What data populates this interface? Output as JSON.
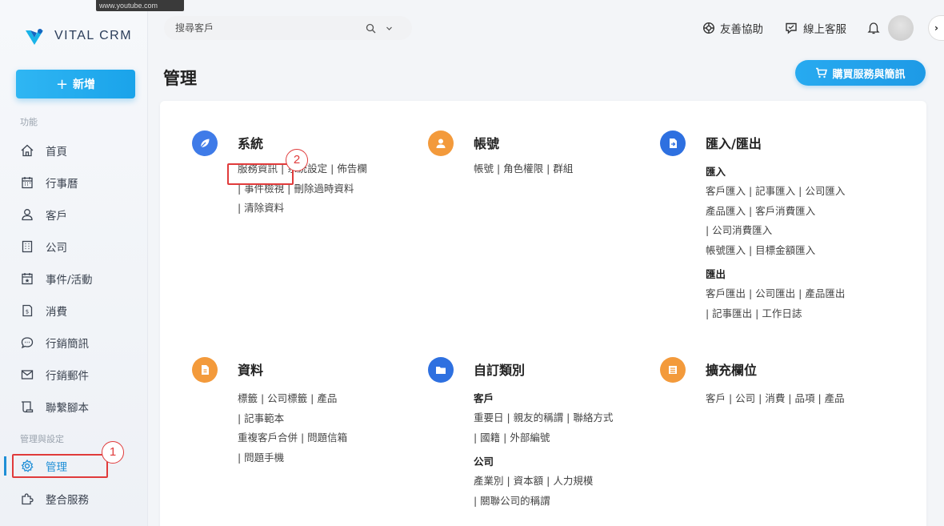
{
  "tooltip": "www.youtube.com",
  "logo": {
    "text": "VITAL CRM"
  },
  "sidebar": {
    "add_label": "新增",
    "section_function": "功能",
    "section_admin": "管理與設定",
    "items": [
      {
        "label": "首頁",
        "icon": "home-icon"
      },
      {
        "label": "行事曆",
        "icon": "calendar-icon"
      },
      {
        "label": "客戶",
        "icon": "customers-icon"
      },
      {
        "label": "公司",
        "icon": "building-icon"
      },
      {
        "label": "事件/活動",
        "icon": "event-icon"
      },
      {
        "label": "消費",
        "icon": "receipt-icon"
      },
      {
        "label": "行銷簡訊",
        "icon": "sms-icon"
      },
      {
        "label": "行銷郵件",
        "icon": "mail-icon"
      },
      {
        "label": "聯繫腳本",
        "icon": "script-icon"
      }
    ],
    "admin_items": [
      {
        "label": "管理",
        "icon": "gear-icon",
        "active": true
      },
      {
        "label": "整合服務",
        "icon": "puzzle-icon"
      }
    ]
  },
  "header": {
    "search_placeholder": "搜尋客戶",
    "help_label": "友善協助",
    "support_label": "線上客服"
  },
  "page": {
    "title": "管理",
    "buy_label": "購買服務與簡訊"
  },
  "annotations": {
    "one": "1",
    "two": "2"
  },
  "modules": {
    "system": {
      "title": "系統",
      "lines": [
        "服務資訊 | 系統設定 | 佈告欄",
        "| 事件檢視 | 刪除過時資料",
        "| 清除資料"
      ]
    },
    "account": {
      "title": "帳號",
      "lines": [
        "帳號 | 角色權限 | 群組"
      ]
    },
    "import_export": {
      "title": "匯入/匯出",
      "import_heading": "匯入",
      "import_lines": [
        "客戶匯入 | 記事匯入 | 公司匯入",
        "產品匯入 | 客戶消費匯入",
        "| 公司消費匯入",
        "帳號匯入 | 目標金額匯入"
      ],
      "export_heading": "匯出",
      "export_lines": [
        "客戶匯出 | 公司匯出 | 產品匯出",
        "| 記事匯出 | 工作日誌"
      ]
    },
    "data": {
      "title": "資料",
      "lines": [
        "標籤 | 公司標籤 | 產品",
        "| 記事範本",
        "重複客戶合併 | 問題信箱",
        "| 問題手機"
      ]
    },
    "custom": {
      "title": "自訂類別",
      "customer_heading": "客戶",
      "customer_lines": [
        "重要日 | 親友的稱謂 | 聯絡方式",
        "| 國籍 | 外部編號"
      ],
      "company_heading": "公司",
      "company_lines": [
        "產業別 | 資本額 | 人力規模",
        "| 關聯公司的稱謂"
      ]
    },
    "extended": {
      "title": "擴充欄位",
      "lines": [
        "客戶 | 公司 | 消費 | 品項 | 產品"
      ]
    }
  },
  "colors": {
    "accent": "#1f8fd6",
    "annotation": "#e03b3b",
    "orange": "#f39a3b",
    "blue": "#3f7be8"
  }
}
